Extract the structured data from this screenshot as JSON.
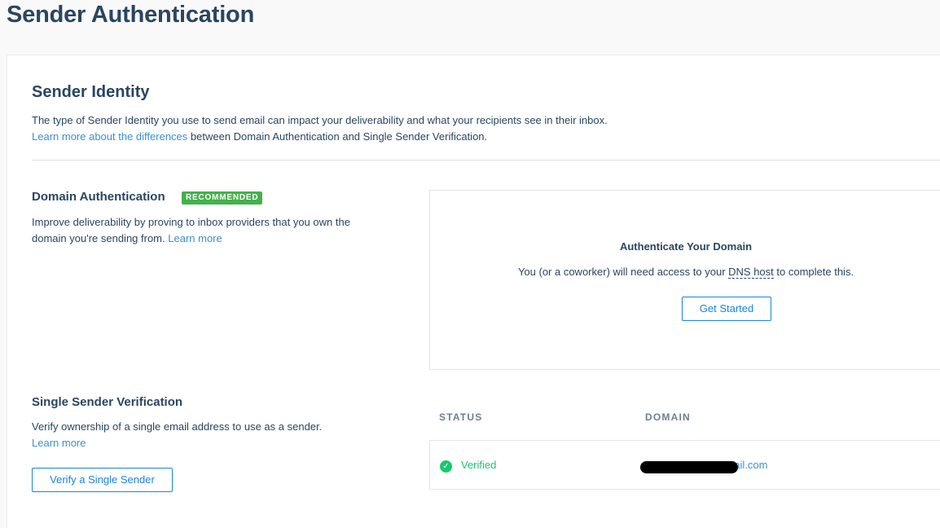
{
  "page": {
    "title": "Sender Authentication"
  },
  "identity": {
    "title": "Sender Identity",
    "description": "The type of Sender Identity you use to send email can impact your deliverability and what your recipients see in their inbox.",
    "learn_link": "Learn more about the differences",
    "learn_suffix": " between Domain Authentication and Single Sender Verification."
  },
  "domain_auth": {
    "title": "Domain Authentication",
    "badge": "RECOMMENDED",
    "description": "Improve deliverability by proving to inbox providers that you own the domain you're sending from.",
    "learn_link": "Learn more",
    "box_heading": "Authenticate Your Domain",
    "box_text_prefix": "You (or a coworker) will need access to your ",
    "box_text_dns": "DNS host",
    "box_text_suffix": " to complete this.",
    "button": "Get Started"
  },
  "single_sender": {
    "title": "Single Sender Verification",
    "description": "Verify ownership of a single email address to use as a sender.",
    "learn_link": "Learn more",
    "button": "Verify a Single Sender"
  },
  "table": {
    "headers": [
      "STATUS",
      "DOMAIN"
    ],
    "rows": [
      {
        "status": "Verified",
        "domain": "nail.com"
      }
    ]
  },
  "colors": {
    "heading": "#294661",
    "link": "#1a82e2",
    "recommended_badge": "#44b14b",
    "verified": "#18c96e"
  },
  "icons": {
    "status_verified": "check-circle-icon"
  }
}
